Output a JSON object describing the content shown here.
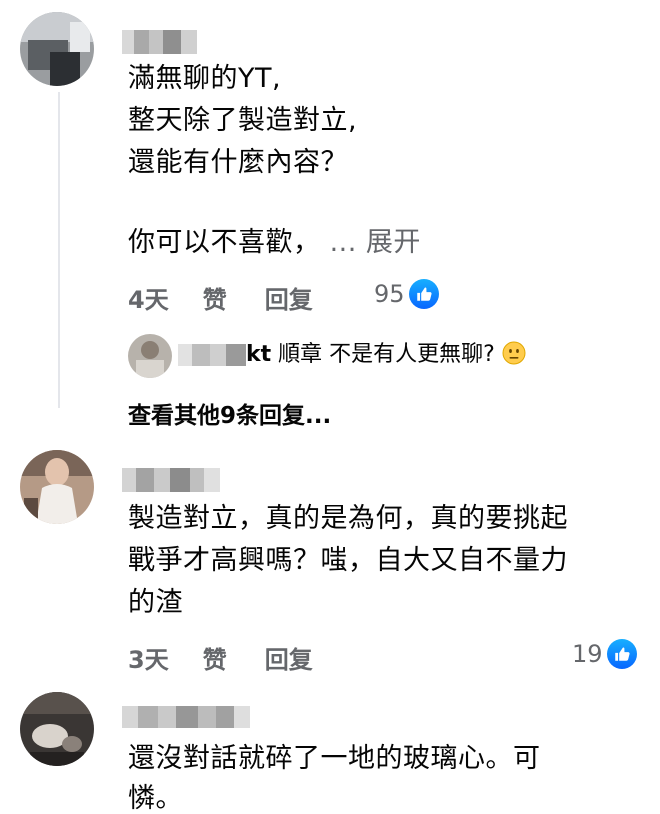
{
  "comments": [
    {
      "text_lines": [
        "滿無聊的YT,",
        "整天除了製造對立,",
        "還能有什麼內容？",
        "",
        "你可以不喜歡，"
      ],
      "see_more": "... 展开",
      "time": "4天",
      "like_label": "赞",
      "reply_label": "回复",
      "reaction_count": "95",
      "reply_preview": {
        "name_visible": "kt",
        "text": "順章 不是有人更無聊?"
      },
      "view_more_replies": "查看其他9条回复..."
    },
    {
      "text_lines": [
        "製造對立，真的是為何，真的要挑起",
        "戰爭才高興嗎？嗤，自大又自不量力",
        "的渣"
      ],
      "time": "3天",
      "like_label": "赞",
      "reply_label": "回复",
      "reaction_count": "19"
    },
    {
      "text_lines": [
        "還沒對話就碎了一地的玻璃心。可",
        "憐。"
      ]
    }
  ],
  "colors": {
    "meta_text": "#65676b",
    "like_badge": "#0866ff",
    "thread_line": "#e4e6eb"
  },
  "icons": [
    "thumbs-up-icon",
    "neutral-face-emoji"
  ]
}
